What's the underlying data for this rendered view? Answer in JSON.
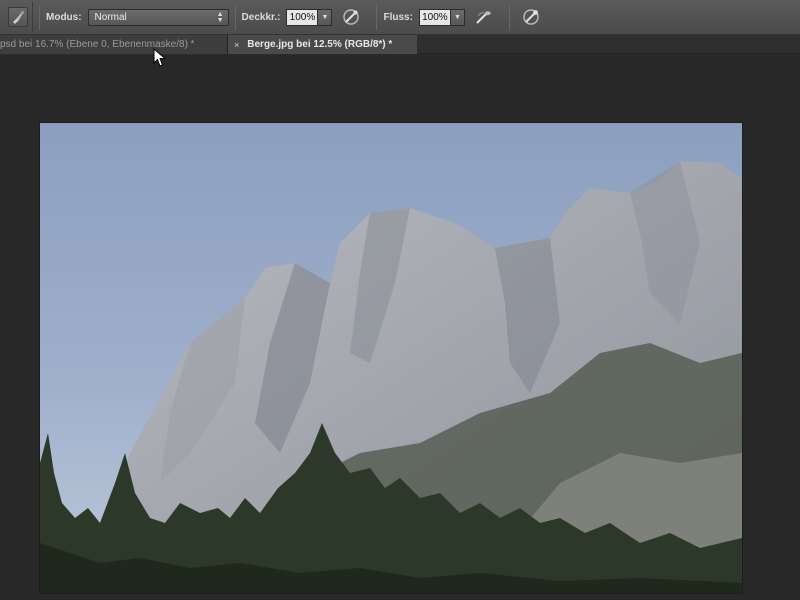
{
  "options_bar": {
    "tool_icon": "brush-preset-icon",
    "mode_label": "Modus:",
    "mode_value": "Normal",
    "opacity_label": "Deckkr.:",
    "opacity_value": "100%",
    "opacity_pressure_icon": "pressure-opacity-icon",
    "flow_label": "Fluss:",
    "flow_value": "100%",
    "airbrush_icon": "airbrush-icon",
    "pressure_size_icon": "pressure-size-icon"
  },
  "tabs": [
    {
      "label": "psd bei 16.7% (Ebene 0, Ebenenmaske/8) *",
      "active": false
    },
    {
      "label": "Berge.jpg bei 12.5% (RGB/8*) *",
      "active": true,
      "close_glyph": "×"
    }
  ],
  "document": {
    "content": "mountain-photo"
  },
  "colors": {
    "sky_top": "#8c9fc0",
    "sky_bottom": "#a8b8d2",
    "rock": "#a8aab0",
    "rock_shadow": "#6f737c",
    "forest": "#2f3a2c",
    "workspace": "#282828",
    "toolbar": "#505050"
  }
}
